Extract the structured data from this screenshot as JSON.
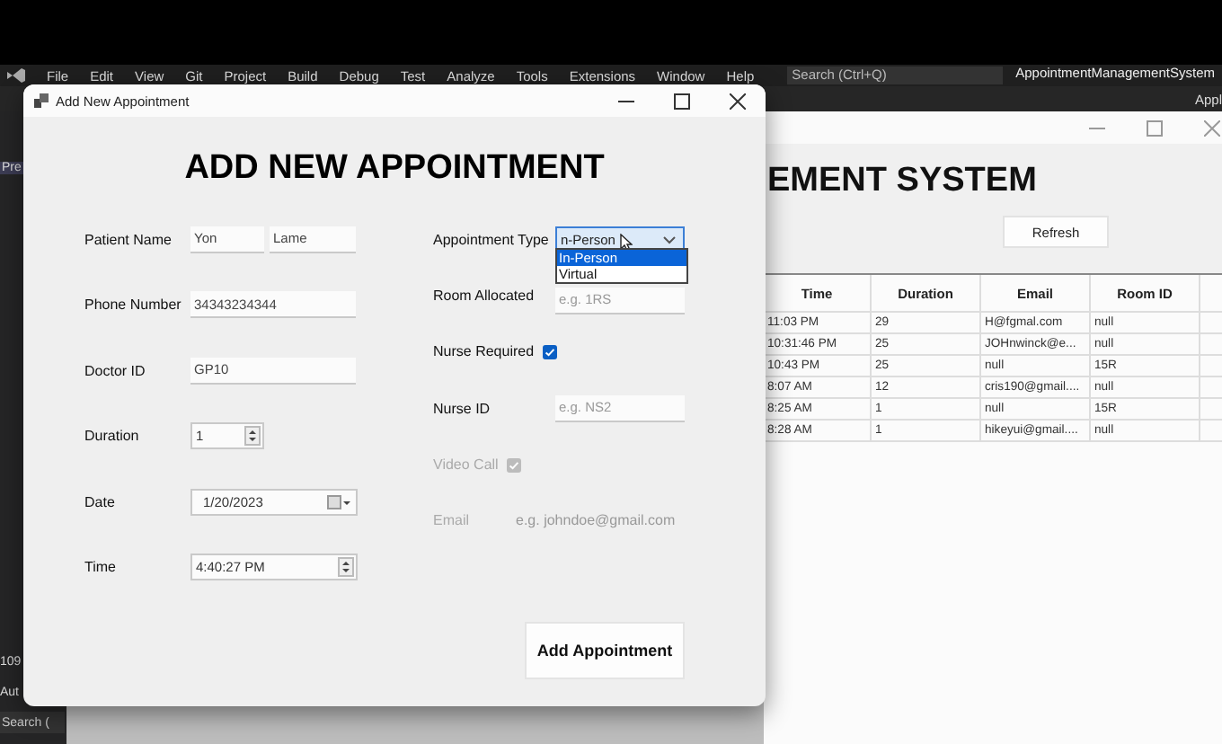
{
  "ide": {
    "menu": [
      "File",
      "Edit",
      "View",
      "Git",
      "Project",
      "Build",
      "Debug",
      "Test",
      "Analyze",
      "Tools",
      "Extensions",
      "Window",
      "Help"
    ],
    "search": {
      "placeholder": "Search (Ctrl+Q)"
    },
    "solution_name": "AppointmentManagementSystem",
    "toolbar_label": "Appl",
    "left_panel": {
      "tab": "Pre",
      "line_number": "109",
      "tab_2": "Aut",
      "search": {
        "placeholder": "Search ("
      }
    }
  },
  "main_window": {
    "heading": "EMENT SYSTEM",
    "refresh_button": "Refresh",
    "table": {
      "columns": [
        "Time",
        "Duration",
        "Email",
        "Room ID"
      ],
      "rows": [
        [
          "11:03 PM",
          "29",
          "H@fgmal.com",
          "null"
        ],
        [
          "10:31:46 PM",
          "25",
          "JOHnwinck@e...",
          "null"
        ],
        [
          "10:43 PM",
          "25",
          "null",
          "15R"
        ],
        [
          "8:07 AM",
          "12",
          "cris190@gmail....",
          "null"
        ],
        [
          "8:25 AM",
          "1",
          "null",
          "15R"
        ],
        [
          "8:28 AM",
          "1",
          "hikeyui@gmail....",
          "null"
        ]
      ]
    }
  },
  "dialog": {
    "title": "Add New Appointment",
    "heading": "ADD NEW APPOINTMENT",
    "patient_name": {
      "label": "Patient Name",
      "first": "Yon",
      "last": "Lame"
    },
    "phone": {
      "label": "Phone Number",
      "value": "34343234344"
    },
    "doctor_id": {
      "label": "Doctor ID",
      "value": "GP10"
    },
    "duration": {
      "label": "Duration",
      "value": "1"
    },
    "date": {
      "label": "Date",
      "value": "1/20/2023"
    },
    "time": {
      "label": "Time",
      "value": "4:40:27 PM"
    },
    "appointment_type": {
      "label": "Appointment Type",
      "value": "n-Person",
      "expanded": true,
      "options": [
        {
          "label": "In-Person",
          "selected": true
        },
        {
          "label": "Virtual",
          "selected": false
        }
      ]
    },
    "room": {
      "label": "Room Allocated",
      "placeholder": "e.g. 1RS"
    },
    "nurse_required": {
      "label": "Nurse Required",
      "checked": true
    },
    "nurse_id": {
      "label": "Nurse ID",
      "placeholder": "e.g. NS2"
    },
    "video_call": {
      "label": "Video Call",
      "checked": true,
      "disabled": true
    },
    "email": {
      "label": "Email",
      "placeholder": "e.g. johndoe@gmail.com",
      "disabled": true
    },
    "submit": "Add Appointment"
  }
}
